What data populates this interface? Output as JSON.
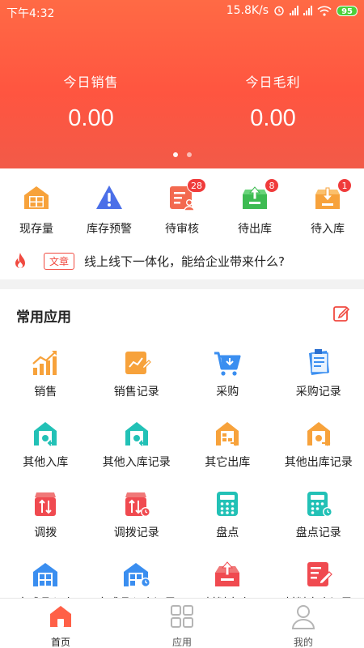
{
  "status_bar": {
    "time": "下午4:32",
    "net_speed": "15.8K/s",
    "battery": "95"
  },
  "header": {
    "stats": [
      {
        "label": "今日销售",
        "value": "0.00"
      },
      {
        "label": "今日毛利",
        "value": "0.00"
      }
    ],
    "carousel_pages": 2
  },
  "shortcuts": [
    {
      "label": "现存量",
      "icon": "warehouse-icon",
      "badge": ""
    },
    {
      "label": "库存预警",
      "icon": "warning-icon",
      "badge": ""
    },
    {
      "label": "待审核",
      "icon": "audit-icon",
      "badge": "28"
    },
    {
      "label": "待出库",
      "icon": "outbound-box-icon",
      "badge": "8"
    },
    {
      "label": "待入库",
      "icon": "inbound-box-icon",
      "badge": "1"
    }
  ],
  "news": {
    "tag": "文章",
    "text": "线上线下一体化，能给企业带来什么?"
  },
  "common_apps": {
    "title": "常用应用",
    "rows": [
      [
        {
          "label": "销售",
          "icon": "sales-chart-icon"
        },
        {
          "label": "销售记录",
          "icon": "sales-record-icon"
        },
        {
          "label": "采购",
          "icon": "cart-icon"
        },
        {
          "label": "采购记录",
          "icon": "purchase-record-icon"
        }
      ],
      [
        {
          "label": "其他入库",
          "icon": "other-inbound-icon"
        },
        {
          "label": "其他入库记录",
          "icon": "other-inbound-record-icon"
        },
        {
          "label": "其它出库",
          "icon": "other-outbound-icon"
        },
        {
          "label": "其他出库记录",
          "icon": "other-outbound-record-icon"
        }
      ],
      [
        {
          "label": "调拨",
          "icon": "transfer-icon"
        },
        {
          "label": "调拨记录",
          "icon": "transfer-record-icon"
        },
        {
          "label": "盘点",
          "icon": "stocktake-icon"
        },
        {
          "label": "盘点记录",
          "icon": "stocktake-record-icon"
        }
      ],
      [
        {
          "label": "完成品入库",
          "icon": "finished-inbound-icon"
        },
        {
          "label": "完成品入库记录",
          "icon": "finished-inbound-record-icon"
        },
        {
          "label": "材料出库",
          "icon": "material-outbound-icon"
        },
        {
          "label": "材料出库记录",
          "icon": "material-outbound-record-icon"
        }
      ]
    ]
  },
  "tabs": [
    {
      "label": "首页",
      "icon": "home-icon",
      "active": true
    },
    {
      "label": "应用",
      "icon": "apps-grid-icon",
      "active": false
    },
    {
      "label": "我的",
      "icon": "user-icon",
      "active": false
    }
  ],
  "colors": {
    "brand_red": "#ff5a42",
    "badge_red": "#f03b3b",
    "orange": "#f7a23b",
    "teal": "#22c1b6",
    "blue": "#3a8ef0"
  }
}
